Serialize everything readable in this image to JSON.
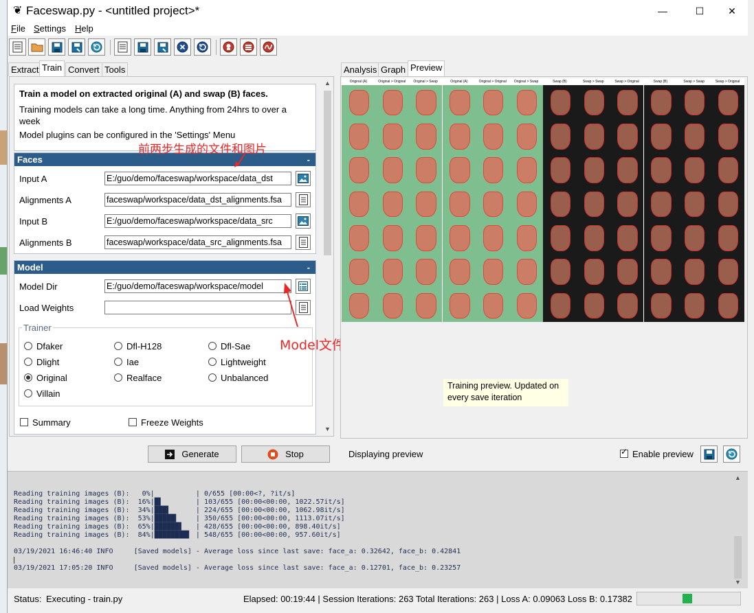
{
  "window": {
    "title": "Faceswap.py - <untitled project>*",
    "controls": [
      "—",
      "☐",
      "✕"
    ]
  },
  "menu": [
    {
      "accel": "F",
      "rest": "ile"
    },
    {
      "accel": "S",
      "rest": "ettings"
    },
    {
      "accel": "H",
      "rest": "elp"
    }
  ],
  "tabs": {
    "main": [
      "Extract",
      "Train",
      "Convert",
      "Tools"
    ],
    "display": [
      "Analysis",
      "Graph",
      "Preview"
    ]
  },
  "info": {
    "heading": "Train a model on extracted original (A) and swap (B) faces.",
    "line1": "Training models can take a long time. Anything from 24hrs to over a week",
    "line2": "Model plugins can be configured in the 'Settings' Menu"
  },
  "faces": {
    "title": "Faces",
    "collapse": "-",
    "input_a_label": "Input A",
    "input_a": "E:/guo/demo/faceswap/workspace/data_dst",
    "align_a_label": "Alignments A",
    "align_a": "faceswap/workspace/data_dst_alignments.fsa",
    "input_b_label": "Input B",
    "input_b": "E:/guo/demo/faceswap/workspace/data_src",
    "align_b_label": "Alignments B",
    "align_b": "faceswap/workspace/data_src_alignments.fsa"
  },
  "model": {
    "title": "Model",
    "collapse": "-",
    "dir_label": "Model Dir",
    "dir": "E:/guo/demo/faceswap/workspace/model",
    "weights_label": "Load Weights",
    "weights": "",
    "trainer_label": "Trainer",
    "trainers": [
      "Dfaker",
      "Dfl-H128",
      "Dfl-Sae",
      "Dlight",
      "Iae",
      "Lightweight",
      "Original",
      "Realface",
      "Unbalanced",
      "Villain"
    ],
    "selected_trainer": "Original",
    "summary_label": "Summary",
    "freeze_label": "Freeze Weights"
  },
  "annotations": {
    "files": "前两步生成的文件和图片",
    "model": "Model文件存放位置"
  },
  "buttons": {
    "generate": "Generate",
    "stop": "Stop"
  },
  "preview": {
    "headers": [
      "Original (A)",
      "Original > Original",
      "Original > Swap",
      "Original (A)",
      "Original > Original",
      "Original > Swap",
      "Swap (B)",
      "Swap > Swap",
      "Swap > Original",
      "Swap (B)",
      "Swap > Swap",
      "Swap > Original"
    ],
    "tooltip": "Training preview. Updated on every save iteration",
    "status": "Displaying preview",
    "enable_label": "Enable preview",
    "enabled": true
  },
  "console": {
    "progress": [
      "Reading training images (B):   0%|          | 0/655 [00:00<?, ?it/s]",
      "Reading training images (B):  16%|█▌        | 103/655 [00:00<00:00, 1022.57it/s]",
      "Reading training images (B):  34%|███▍      | 224/655 [00:00<00:00, 1062.98it/s]",
      "Reading training images (B):  53%|█████▎    | 350/655 [00:00<00:00, 1113.07it/s]",
      "Reading training images (B):  65%|██████▌   | 428/655 [00:00<00:00, 898.40it/s]",
      "Reading training images (B):  84%|████████▍ | 548/655 [00:00<00:00, 957.60it/s]"
    ],
    "log1": "03/19/2021 16:46:40 INFO     [Saved models] - Average loss since last save: face_a: 0.32642, face_b: 0.42841",
    "log2": "03/19/2021 17:05:20 INFO     [Saved models] - Average loss since last save: face_a: 0.12701, face_b: 0.23257"
  },
  "status": {
    "label": "Status:",
    "value": "Executing - train.py",
    "stats": "Elapsed: 00:19:44 | Session Iterations: 263  Total Iterations: 263 | Loss A: 0.09063  Loss B: 0.17382"
  },
  "colors": {
    "section_header": "#2c5d8a",
    "annotation": "#e82727",
    "progress": "#22b14c"
  }
}
